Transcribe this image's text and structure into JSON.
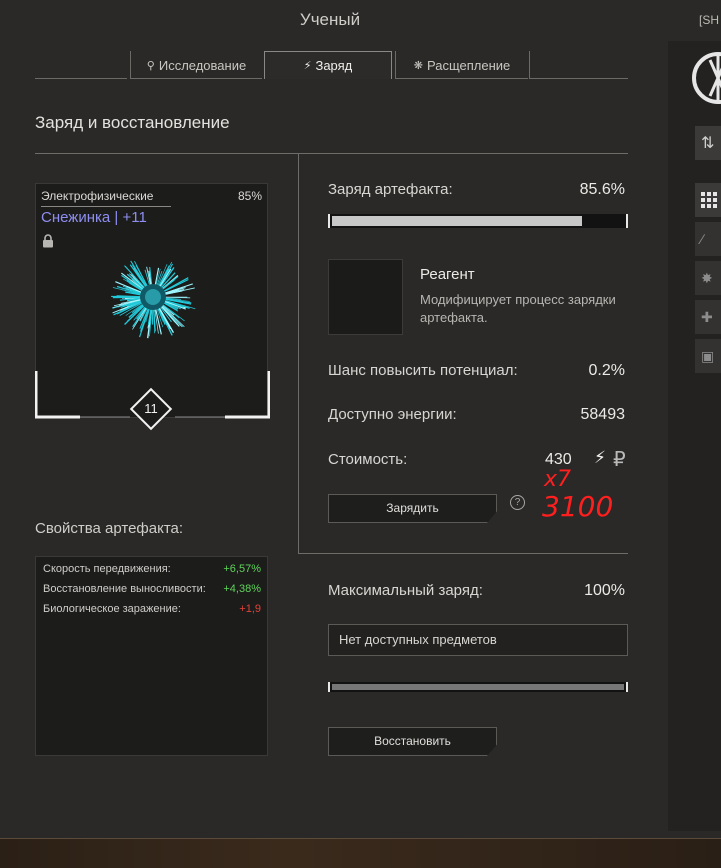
{
  "window": {
    "title": "Ученый",
    "corner_tag": "[SH"
  },
  "tabs": [
    {
      "label": "Исследование",
      "icon": "search-icon"
    },
    {
      "label": "Заряд",
      "icon": "lightning-icon"
    },
    {
      "label": "Расщепление",
      "icon": "split-icon"
    }
  ],
  "section": {
    "title": "Заряд и восстановление"
  },
  "artifact": {
    "category": "Электрофизические",
    "percent": "85%",
    "name": "Снежинка | +11",
    "level": "11",
    "icon": "lock-icon",
    "accent_color": "#8e8ef0"
  },
  "properties": {
    "title": "Свойства артефакта:",
    "items": [
      {
        "label": "Скорость передвижения:",
        "value": "+6,57%",
        "color": "#5fd35a"
      },
      {
        "label": "Восстановление выносливости:",
        "value": "+4,38%",
        "color": "#5fd35a"
      },
      {
        "label": "Биологическое заражение:",
        "value": "+1,9",
        "color": "#e0433b"
      }
    ]
  },
  "charge": {
    "label": "Заряд артефакта:",
    "value": "85.6%",
    "fill_percent": 85.6,
    "reagent_title": "Реагент",
    "reagent_desc": "Модифицирует процесс зарядки артефакта.",
    "chance_label": "Шанс повысить потенциал:",
    "chance_value": "0.2%",
    "energy_label": "Доступно энергии:",
    "energy_value": "58493",
    "cost_label": "Стоимость:",
    "cost_value": "430",
    "charge_button": "Зарядить",
    "help": "?"
  },
  "annotation": {
    "line1": "x7",
    "line2": "3100",
    "color": "#ff1f1f"
  },
  "restore": {
    "max_label": "Максимальный заряд:",
    "max_value": "100%",
    "select_placeholder": "Нет доступных предметов",
    "fill_percent": 100,
    "restore_button": "Восстановить"
  }
}
